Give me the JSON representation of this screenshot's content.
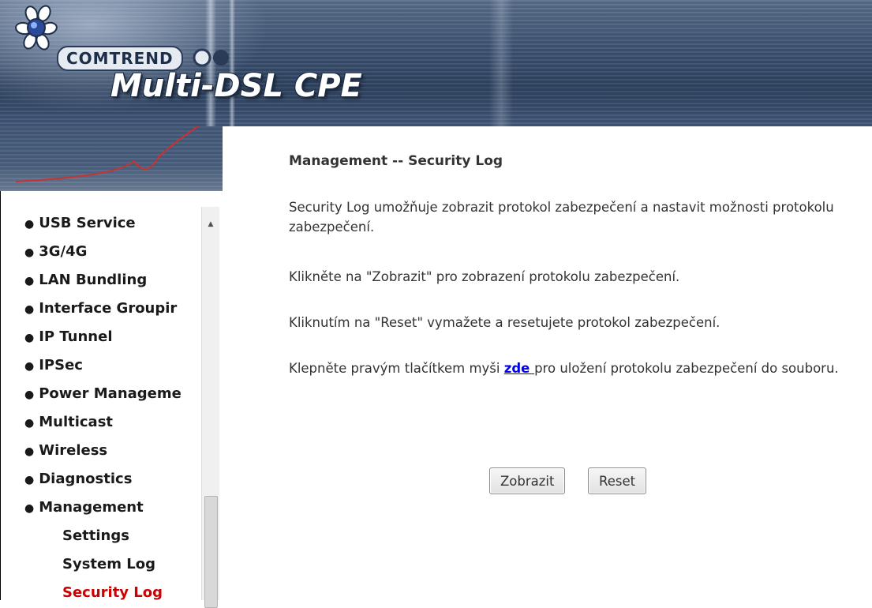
{
  "header": {
    "brand": "COMTREND",
    "product": "Multi-DSL CPE"
  },
  "sidebar": {
    "items": [
      {
        "label": "USB Service"
      },
      {
        "label": "3G/4G"
      },
      {
        "label": "LAN Bundling"
      },
      {
        "label": "Interface Groupir"
      },
      {
        "label": "IP Tunnel"
      },
      {
        "label": "IPSec"
      },
      {
        "label": "Power Manageme"
      },
      {
        "label": "Multicast"
      },
      {
        "label": "Wireless"
      },
      {
        "label": "Diagnostics"
      },
      {
        "label": "Management"
      }
    ],
    "subitems": [
      {
        "label": "Settings"
      },
      {
        "label": "System Log"
      },
      {
        "label": "Security Log",
        "active": true
      }
    ]
  },
  "content": {
    "title": "Management -- Security Log",
    "p1": "Security Log umožňuje zobrazit protokol zabezpečení a nastavit možnosti protokolu zabezpečení.",
    "p2": "Klikněte na \"Zobrazit\" pro zobrazení protokolu zabezpečení.",
    "p3": "Kliknutím na \"Reset\" vymažete a resetujete protokol zabezpečení.",
    "p4_before": "Klepněte pravým tlačítkem myši ",
    "p4_link": "zde ",
    "p4_after": "pro uložení protokolu zabezpečení do souboru.",
    "buttons": {
      "view": "Zobrazit",
      "reset": "Reset"
    }
  },
  "colors": {
    "active_nav": "#cc0000",
    "link": "#0000ee",
    "header_dark": "#2e4361"
  },
  "icons": {
    "logo": "comtrend-flower-icon",
    "scroll_up": "scroll-up-arrow-icon"
  }
}
